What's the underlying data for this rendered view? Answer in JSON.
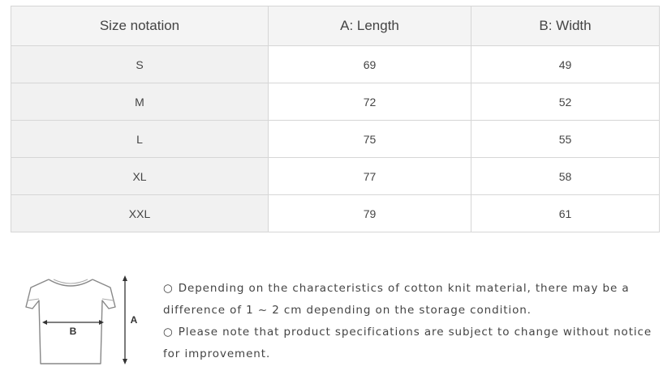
{
  "table": {
    "headers": [
      "Size notation",
      "A: Length",
      "B: Width"
    ],
    "rows": [
      {
        "size": "S",
        "length": "69",
        "width": "49"
      },
      {
        "size": "M",
        "length": "72",
        "width": "52"
      },
      {
        "size": "L",
        "length": "75",
        "width": "55"
      },
      {
        "size": "XL",
        "length": "77",
        "width": "58"
      },
      {
        "size": "XXL",
        "length": "79",
        "width": "61"
      }
    ]
  },
  "diagram": {
    "label_a": "A",
    "label_b": "B"
  },
  "notes": [
    {
      "bullet": "○",
      "text": "Depending on the characteristics of cotton knit material, there may be a difference of 1 ~ 2 cm depending on the storage condition."
    },
    {
      "bullet": "○",
      "text": "Please note that product specifications are subject to change without notice for improvement."
    }
  ]
}
